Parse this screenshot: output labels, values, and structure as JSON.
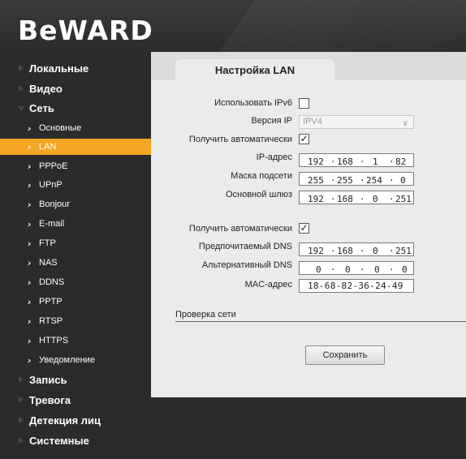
{
  "brand": {
    "logo": "BeWARD"
  },
  "sidebar": {
    "sections": [
      {
        "label": "Локальные"
      },
      {
        "label": "Видео"
      },
      {
        "label": "Сеть"
      }
    ],
    "network_items": [
      {
        "label": "Основные"
      },
      {
        "label": "LAN"
      },
      {
        "label": "PPPoE"
      },
      {
        "label": "UPnP"
      },
      {
        "label": "Bonjour"
      },
      {
        "label": "E-mail"
      },
      {
        "label": "FTP"
      },
      {
        "label": "NAS"
      },
      {
        "label": "DDNS"
      },
      {
        "label": "PPTP"
      },
      {
        "label": "RTSP"
      },
      {
        "label": "HTTPS"
      },
      {
        "label": "Уведомление"
      }
    ],
    "bottom_sections": [
      {
        "label": "Запись"
      },
      {
        "label": "Тревога"
      },
      {
        "label": "Детекция лиц"
      },
      {
        "label": "Системные"
      }
    ],
    "active_item": "LAN",
    "accent_color": "#f5a623"
  },
  "main": {
    "tab_title": "Настройка LAN",
    "use_ipv6": {
      "label": "Использовать IPv6",
      "checked": false
    },
    "ip_version": {
      "label": "Версия IP",
      "value": "IPV4"
    },
    "auto_ip": {
      "label": "Получить автоматически",
      "checked": true,
      "mark": "✓"
    },
    "ip_address": {
      "label": "IP-адрес",
      "octets": [
        "192",
        "168",
        "1",
        "82"
      ]
    },
    "subnet_mask": {
      "label": "Маска подсети",
      "octets": [
        "255",
        "255",
        "254",
        "0"
      ]
    },
    "gateway": {
      "label": "Основной шлюз",
      "octets": [
        "192",
        "168",
        "0",
        "251"
      ]
    },
    "auto_dns": {
      "label": "Получить автоматически",
      "checked": true,
      "mark": "✓"
    },
    "preferred_dns": {
      "label": "Предпочитаемый DNS",
      "octets": [
        "192",
        "168",
        "0",
        "251"
      ]
    },
    "alternate_dns": {
      "label": "Альтернативный DNS",
      "octets": [
        "0",
        "0",
        "0",
        "0"
      ]
    },
    "mac_address": {
      "label": "MAC-адрес",
      "value": "18-68-82-36-24-49"
    },
    "network_check": {
      "title": "Проверка сети"
    },
    "save_label": "Сохранить"
  }
}
